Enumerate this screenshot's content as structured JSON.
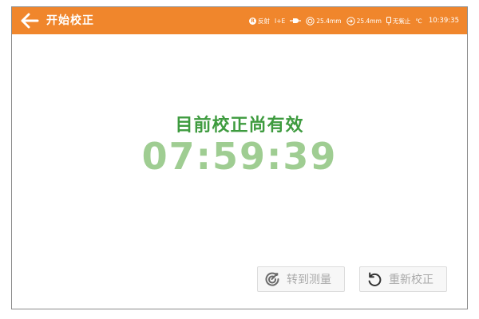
{
  "header": {
    "title": "开始校正",
    "status": {
      "mode_icon_letter": "R",
      "mode_label": "反射",
      "ie_label": "I+E",
      "aperture_1": "25.4mm",
      "aperture_2": "25.4mm",
      "uv_label": "无紫止",
      "temp_unit": "℃",
      "time": "10:39:35"
    }
  },
  "main": {
    "message": "目前校正尚有效",
    "countdown": "07:59:39"
  },
  "buttons": {
    "go_measure_label": "转到测量",
    "recalibrate_label": "重新校正"
  },
  "colors": {
    "header_bg": "#f0862c",
    "message": "#3e9b3f",
    "countdown": "#9fcd92",
    "button_text": "#a9a9a9"
  },
  "icons": {
    "back": "arrow-left-icon",
    "measure": "target-check-icon",
    "recalibrate": "rotate-ccw-icon"
  }
}
